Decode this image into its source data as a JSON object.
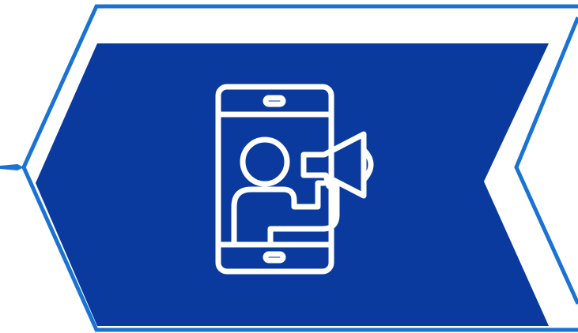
{
  "colors": {
    "background": "#ffffff",
    "outline_blue": "#1a73d4",
    "fill_navy": "#0a3a9e",
    "icon_stroke": "#ffffff"
  },
  "graphic": {
    "shape": "chevron-arrow-banner",
    "icon": "smartphone-person-megaphone-icon"
  }
}
